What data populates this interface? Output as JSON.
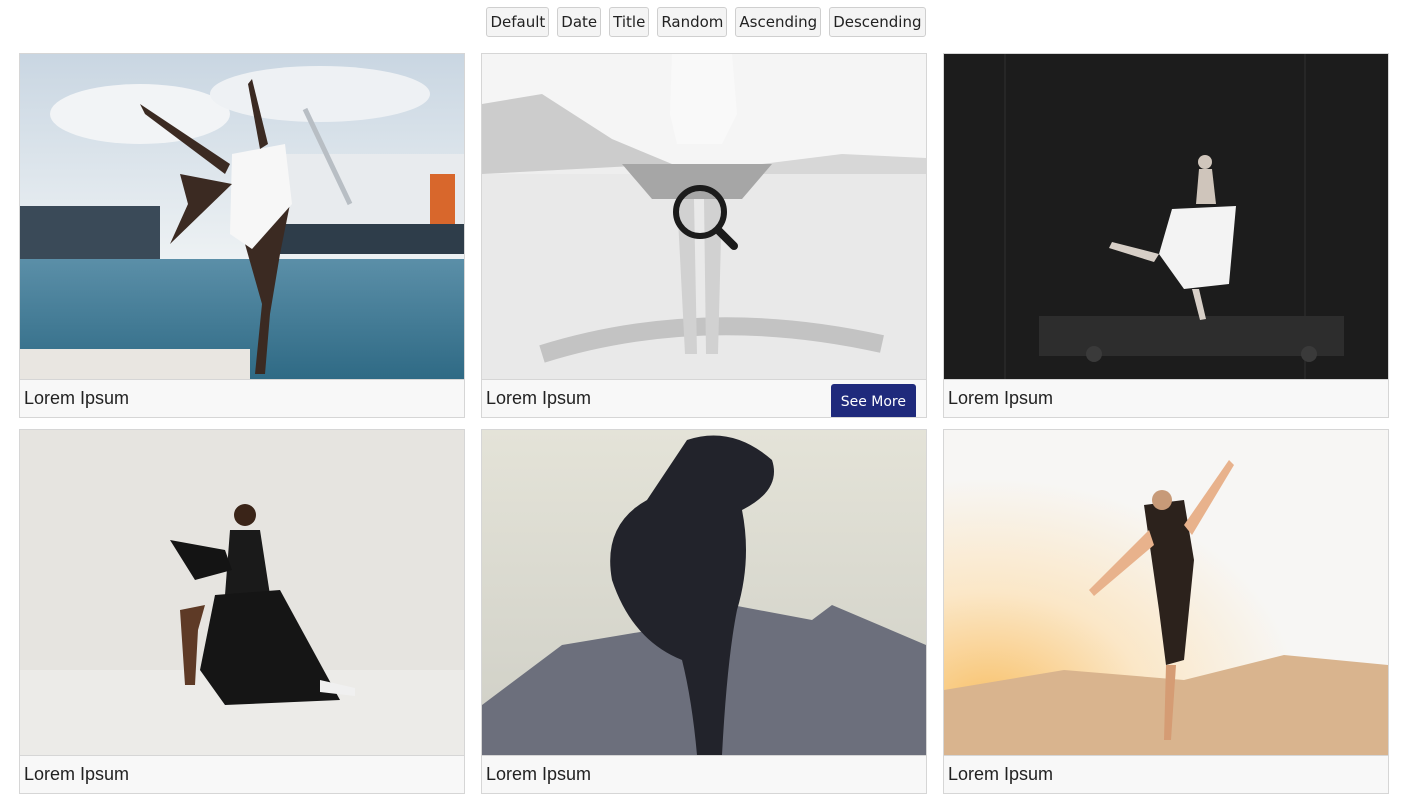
{
  "sort_buttons": [
    "Default",
    "Date",
    "Title",
    "Random",
    "Ascending",
    "Descending"
  ],
  "cards": [
    {
      "title": "Lorem Ipsum",
      "photo": "dancer-harbor-photo"
    },
    {
      "title": "Lorem Ipsum",
      "photo": "dancer-tutu-desert-photo",
      "button": "See More",
      "hovered": true
    },
    {
      "title": "Lorem Ipsum",
      "photo": "ballerina-dark-wall-photo"
    },
    {
      "title": "Lorem Ipsum",
      "photo": "dancer-black-dress-photo"
    },
    {
      "title": "Lorem Ipsum",
      "photo": "dancer-silhouette-mountain-photo"
    },
    {
      "title": "Lorem Ipsum",
      "photo": "dancer-jump-sunset-photo"
    }
  ],
  "colors": {
    "button": "#1f2a7c",
    "caption_bg": "#f8f8f8",
    "border": "#d6d6d6"
  }
}
